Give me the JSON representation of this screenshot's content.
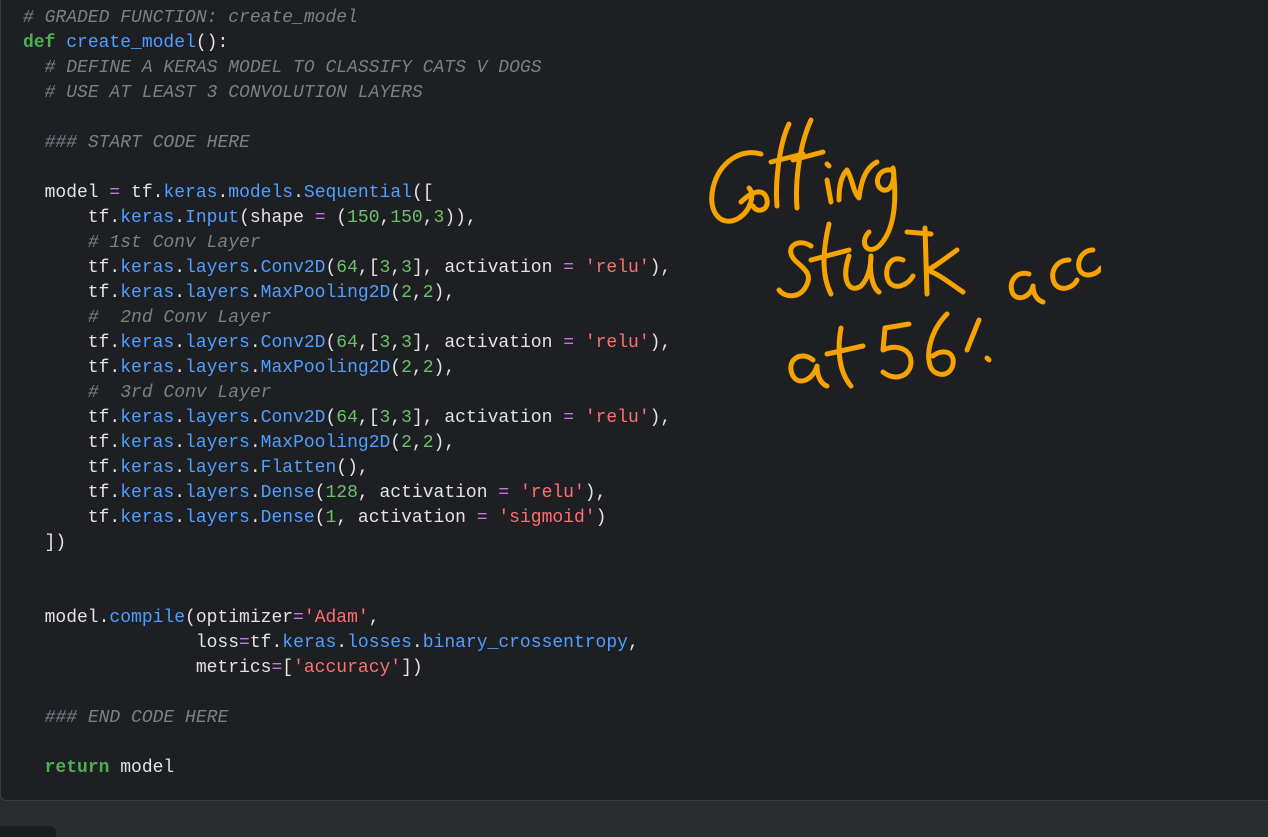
{
  "code_cell": {
    "lines": [
      [
        {
          "t": "# GRADED FUNCTION: create_model",
          "k": "cm"
        }
      ],
      [
        {
          "t": "def",
          "k": "kw"
        },
        {
          "t": " ",
          "k": "id"
        },
        {
          "t": "create_model",
          "k": "fn"
        },
        {
          "t": "():",
          "k": "pun"
        }
      ],
      [
        {
          "t": "  ",
          "k": "id"
        },
        {
          "t": "# DEFINE A KERAS MODEL TO CLASSIFY CATS V DOGS",
          "k": "cm"
        }
      ],
      [
        {
          "t": "  ",
          "k": "id"
        },
        {
          "t": "# USE AT LEAST 3 CONVOLUTION LAYERS",
          "k": "cm"
        }
      ],
      [
        {
          "t": "",
          "k": "id"
        }
      ],
      [
        {
          "t": "  ",
          "k": "id"
        },
        {
          "t": "### START CODE HERE",
          "k": "cm"
        }
      ],
      [
        {
          "t": "",
          "k": "id"
        }
      ],
      [
        {
          "t": "  model ",
          "k": "id"
        },
        {
          "t": "=",
          "k": "op"
        },
        {
          "t": " tf.",
          "k": "id"
        },
        {
          "t": "keras",
          "k": "attr"
        },
        {
          "t": ".",
          "k": "pun"
        },
        {
          "t": "models",
          "k": "attr"
        },
        {
          "t": ".",
          "k": "pun"
        },
        {
          "t": "Sequential",
          "k": "attr"
        },
        {
          "t": "([",
          "k": "pun"
        }
      ],
      [
        {
          "t": "      tf.",
          "k": "id"
        },
        {
          "t": "keras",
          "k": "attr"
        },
        {
          "t": ".",
          "k": "pun"
        },
        {
          "t": "Input",
          "k": "attr"
        },
        {
          "t": "(shape ",
          "k": "id"
        },
        {
          "t": "=",
          "k": "op"
        },
        {
          "t": " (",
          "k": "pun"
        },
        {
          "t": "150",
          "k": "num"
        },
        {
          "t": ",",
          "k": "pun"
        },
        {
          "t": "150",
          "k": "num"
        },
        {
          "t": ",",
          "k": "pun"
        },
        {
          "t": "3",
          "k": "num"
        },
        {
          "t": ")),",
          "k": "pun"
        }
      ],
      [
        {
          "t": "      ",
          "k": "id"
        },
        {
          "t": "# 1st Conv Layer",
          "k": "cm"
        }
      ],
      [
        {
          "t": "      tf.",
          "k": "id"
        },
        {
          "t": "keras",
          "k": "attr"
        },
        {
          "t": ".",
          "k": "pun"
        },
        {
          "t": "layers",
          "k": "attr"
        },
        {
          "t": ".",
          "k": "pun"
        },
        {
          "t": "Conv2D",
          "k": "attr"
        },
        {
          "t": "(",
          "k": "pun"
        },
        {
          "t": "64",
          "k": "num"
        },
        {
          "t": ",[",
          "k": "pun"
        },
        {
          "t": "3",
          "k": "num"
        },
        {
          "t": ",",
          "k": "pun"
        },
        {
          "t": "3",
          "k": "num"
        },
        {
          "t": "], activation ",
          "k": "id"
        },
        {
          "t": "=",
          "k": "op"
        },
        {
          "t": " ",
          "k": "id"
        },
        {
          "t": "'relu'",
          "k": "str"
        },
        {
          "t": "),",
          "k": "pun"
        }
      ],
      [
        {
          "t": "      tf.",
          "k": "id"
        },
        {
          "t": "keras",
          "k": "attr"
        },
        {
          "t": ".",
          "k": "pun"
        },
        {
          "t": "layers",
          "k": "attr"
        },
        {
          "t": ".",
          "k": "pun"
        },
        {
          "t": "MaxPooling2D",
          "k": "attr"
        },
        {
          "t": "(",
          "k": "pun"
        },
        {
          "t": "2",
          "k": "num"
        },
        {
          "t": ",",
          "k": "pun"
        },
        {
          "t": "2",
          "k": "num"
        },
        {
          "t": "),",
          "k": "pun"
        }
      ],
      [
        {
          "t": "      ",
          "k": "id"
        },
        {
          "t": "#  2nd Conv Layer",
          "k": "cm"
        }
      ],
      [
        {
          "t": "      tf.",
          "k": "id"
        },
        {
          "t": "keras",
          "k": "attr"
        },
        {
          "t": ".",
          "k": "pun"
        },
        {
          "t": "layers",
          "k": "attr"
        },
        {
          "t": ".",
          "k": "pun"
        },
        {
          "t": "Conv2D",
          "k": "attr"
        },
        {
          "t": "(",
          "k": "pun"
        },
        {
          "t": "64",
          "k": "num"
        },
        {
          "t": ",[",
          "k": "pun"
        },
        {
          "t": "3",
          "k": "num"
        },
        {
          "t": ",",
          "k": "pun"
        },
        {
          "t": "3",
          "k": "num"
        },
        {
          "t": "], activation ",
          "k": "id"
        },
        {
          "t": "=",
          "k": "op"
        },
        {
          "t": " ",
          "k": "id"
        },
        {
          "t": "'relu'",
          "k": "str"
        },
        {
          "t": "),",
          "k": "pun"
        }
      ],
      [
        {
          "t": "      tf.",
          "k": "id"
        },
        {
          "t": "keras",
          "k": "attr"
        },
        {
          "t": ".",
          "k": "pun"
        },
        {
          "t": "layers",
          "k": "attr"
        },
        {
          "t": ".",
          "k": "pun"
        },
        {
          "t": "MaxPooling2D",
          "k": "attr"
        },
        {
          "t": "(",
          "k": "pun"
        },
        {
          "t": "2",
          "k": "num"
        },
        {
          "t": ",",
          "k": "pun"
        },
        {
          "t": "2",
          "k": "num"
        },
        {
          "t": "),",
          "k": "pun"
        }
      ],
      [
        {
          "t": "      ",
          "k": "id"
        },
        {
          "t": "#  3rd Conv Layer",
          "k": "cm"
        }
      ],
      [
        {
          "t": "      tf.",
          "k": "id"
        },
        {
          "t": "keras",
          "k": "attr"
        },
        {
          "t": ".",
          "k": "pun"
        },
        {
          "t": "layers",
          "k": "attr"
        },
        {
          "t": ".",
          "k": "pun"
        },
        {
          "t": "Conv2D",
          "k": "attr"
        },
        {
          "t": "(",
          "k": "pun"
        },
        {
          "t": "64",
          "k": "num"
        },
        {
          "t": ",[",
          "k": "pun"
        },
        {
          "t": "3",
          "k": "num"
        },
        {
          "t": ",",
          "k": "pun"
        },
        {
          "t": "3",
          "k": "num"
        },
        {
          "t": "], activation ",
          "k": "id"
        },
        {
          "t": "=",
          "k": "op"
        },
        {
          "t": " ",
          "k": "id"
        },
        {
          "t": "'relu'",
          "k": "str"
        },
        {
          "t": "),",
          "k": "pun"
        }
      ],
      [
        {
          "t": "      tf.",
          "k": "id"
        },
        {
          "t": "keras",
          "k": "attr"
        },
        {
          "t": ".",
          "k": "pun"
        },
        {
          "t": "layers",
          "k": "attr"
        },
        {
          "t": ".",
          "k": "pun"
        },
        {
          "t": "MaxPooling2D",
          "k": "attr"
        },
        {
          "t": "(",
          "k": "pun"
        },
        {
          "t": "2",
          "k": "num"
        },
        {
          "t": ",",
          "k": "pun"
        },
        {
          "t": "2",
          "k": "num"
        },
        {
          "t": "),",
          "k": "pun"
        }
      ],
      [
        {
          "t": "      tf.",
          "k": "id"
        },
        {
          "t": "keras",
          "k": "attr"
        },
        {
          "t": ".",
          "k": "pun"
        },
        {
          "t": "layers",
          "k": "attr"
        },
        {
          "t": ".",
          "k": "pun"
        },
        {
          "t": "Flatten",
          "k": "attr"
        },
        {
          "t": "(),",
          "k": "pun"
        }
      ],
      [
        {
          "t": "      tf.",
          "k": "id"
        },
        {
          "t": "keras",
          "k": "attr"
        },
        {
          "t": ".",
          "k": "pun"
        },
        {
          "t": "layers",
          "k": "attr"
        },
        {
          "t": ".",
          "k": "pun"
        },
        {
          "t": "Dense",
          "k": "attr"
        },
        {
          "t": "(",
          "k": "pun"
        },
        {
          "t": "128",
          "k": "num"
        },
        {
          "t": ", activation ",
          "k": "id"
        },
        {
          "t": "=",
          "k": "op"
        },
        {
          "t": " ",
          "k": "id"
        },
        {
          "t": "'relu'",
          "k": "str"
        },
        {
          "t": "),",
          "k": "pun"
        }
      ],
      [
        {
          "t": "      tf.",
          "k": "id"
        },
        {
          "t": "keras",
          "k": "attr"
        },
        {
          "t": ".",
          "k": "pun"
        },
        {
          "t": "layers",
          "k": "attr"
        },
        {
          "t": ".",
          "k": "pun"
        },
        {
          "t": "Dense",
          "k": "attr"
        },
        {
          "t": "(",
          "k": "pun"
        },
        {
          "t": "1",
          "k": "num"
        },
        {
          "t": ", activation ",
          "k": "id"
        },
        {
          "t": "=",
          "k": "op"
        },
        {
          "t": " ",
          "k": "id"
        },
        {
          "t": "'sigmoid'",
          "k": "str"
        },
        {
          "t": ")",
          "k": "pun"
        }
      ],
      [
        {
          "t": "  ])",
          "k": "pun"
        }
      ],
      [
        {
          "t": "",
          "k": "id"
        }
      ],
      [
        {
          "t": "",
          "k": "id"
        }
      ],
      [
        {
          "t": "  model.",
          "k": "id"
        },
        {
          "t": "compile",
          "k": "attr"
        },
        {
          "t": "(optimizer",
          "k": "id"
        },
        {
          "t": "=",
          "k": "op"
        },
        {
          "t": "'Adam'",
          "k": "str"
        },
        {
          "t": ",",
          "k": "pun"
        }
      ],
      [
        {
          "t": "                loss",
          "k": "id"
        },
        {
          "t": "=",
          "k": "op"
        },
        {
          "t": "tf.",
          "k": "id"
        },
        {
          "t": "keras",
          "k": "attr"
        },
        {
          "t": ".",
          "k": "pun"
        },
        {
          "t": "losses",
          "k": "attr"
        },
        {
          "t": ".",
          "k": "pun"
        },
        {
          "t": "binary_crossentropy",
          "k": "attr"
        },
        {
          "t": ",",
          "k": "pun"
        }
      ],
      [
        {
          "t": "                metrics",
          "k": "id"
        },
        {
          "t": "=",
          "k": "op"
        },
        {
          "t": "[",
          "k": "pun"
        },
        {
          "t": "'accuracy'",
          "k": "str"
        },
        {
          "t": "])",
          "k": "pun"
        }
      ],
      [
        {
          "t": "",
          "k": "id"
        }
      ],
      [
        {
          "t": "  ",
          "k": "id"
        },
        {
          "t": "### END CODE HERE",
          "k": "cm"
        }
      ],
      [
        {
          "t": "",
          "k": "id"
        }
      ],
      [
        {
          "t": "  ",
          "k": "id"
        },
        {
          "t": "return",
          "k": "kw"
        },
        {
          "t": " model",
          "k": "id"
        }
      ]
    ]
  },
  "handwritten_note": {
    "lines": [
      "Getting",
      "stuck",
      "at 56% acc"
    ],
    "color": "#f5a300"
  },
  "colors": {
    "background": "#1e1f22",
    "keyword": "#4caf50",
    "attribute": "#4f9fff",
    "comment": "#7b7f86",
    "number": "#6cc26a",
    "string": "#ff6f6f",
    "operator": "#c678dd"
  }
}
